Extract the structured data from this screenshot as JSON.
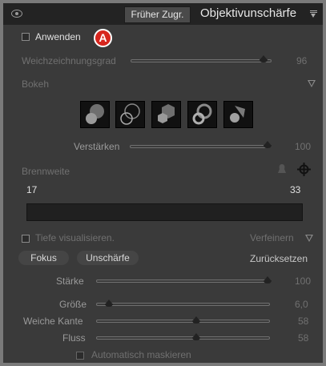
{
  "header": {
    "previous_label": "Früher Zugr.",
    "title": "Objektivunschärfe"
  },
  "badge": "A",
  "apply": {
    "label": "Anwenden",
    "checked": false
  },
  "sliders": {
    "amount": {
      "label": "Weichzeichnungsgrad",
      "value": "96",
      "fraction": 0.96
    },
    "boost": {
      "label": "Verstärken",
      "value": "100",
      "fraction": 1.0
    },
    "strength": {
      "label": "Stärke",
      "value": "100",
      "fraction": 1.0
    },
    "size": {
      "label": "Größe",
      "value": "6,0",
      "fraction": 0.06
    },
    "feather": {
      "label": "Weiche Kante",
      "value": "58",
      "fraction": 0.58
    },
    "flow": {
      "label": "Fluss",
      "value": "58",
      "fraction": 0.58
    }
  },
  "bokeh": {
    "label": "Bokeh",
    "shapes": [
      "circle-icon",
      "ring-icon",
      "hexagon-icon",
      "doughnut-icon",
      "blade-icon"
    ]
  },
  "focal": {
    "label": "Brennweite",
    "min": "17",
    "max": "33"
  },
  "visualize": {
    "label": "Tiefe visualisieren.",
    "checked": false
  },
  "refine": {
    "label": "Verfeinern"
  },
  "buttons": {
    "focus": "Fokus",
    "blur": "Unschärfe",
    "reset": "Zurücksetzen"
  },
  "automask": {
    "label": "Automatisch maskieren",
    "checked": false
  },
  "colors": {
    "accent": "#d7261e",
    "panel": "#3a3a3a"
  }
}
